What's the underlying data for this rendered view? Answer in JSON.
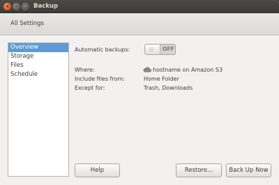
{
  "window": {
    "title": "Backup",
    "close_glyph": "×",
    "minimize_glyph": "–",
    "maximize_glyph": "□"
  },
  "toolbar": {
    "all_settings_label": "All Settings"
  },
  "sidebar": {
    "items": [
      {
        "label": "Overview",
        "selected": true
      },
      {
        "label": "Storage",
        "selected": false
      },
      {
        "label": "Files",
        "selected": false
      },
      {
        "label": "Schedule",
        "selected": false
      }
    ]
  },
  "overview": {
    "automatic_backups_label": "Automatic backups:",
    "automatic_backups_state": "OFF",
    "where_label": "Where:",
    "where_icon": "cloud-icon",
    "where_value": "hostname on Amazon S3",
    "include_label": "Include files from:",
    "include_value": "Home Folder",
    "except_label": "Except for:",
    "except_value": "Trash, Downloads"
  },
  "buttons": {
    "help": "Help",
    "restore": "Restore...",
    "back_up_now": "Back Up Now"
  },
  "colors": {
    "selection": "#5e9bd4",
    "close_button": "#e5561c",
    "titlebar": "#3c3b37"
  }
}
